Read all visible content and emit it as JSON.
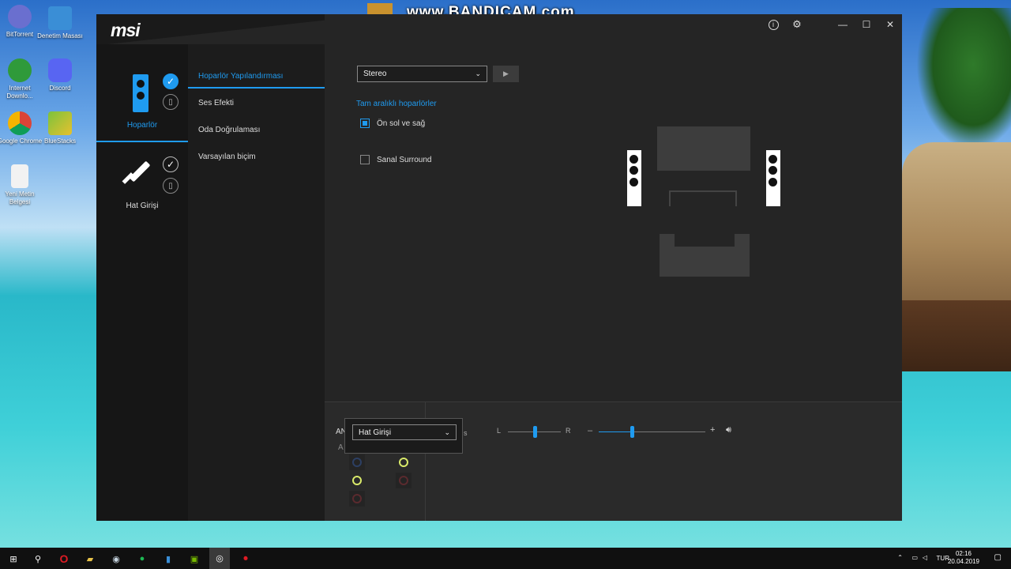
{
  "watermark": "www.BANDICAM.com",
  "desktop_icons": [
    {
      "label": "BitTorrent",
      "color": "#6a6fcf"
    },
    {
      "label": "Denetim Masası",
      "color": "#3a8ed6"
    },
    {
      "label": "Internet Downlo...",
      "color": "#2f9a3a"
    },
    {
      "label": "Discord",
      "color": "#5865f2"
    },
    {
      "label": "Google Chrome",
      "color": "#db4437"
    },
    {
      "label": "BlueStacks",
      "color": "#7cc23c"
    },
    {
      "label": "Yeni Metin Belgesi",
      "color": "#f2f2f2"
    }
  ],
  "window": {
    "brand": "msi",
    "info_icon": "i",
    "settings_icon": "⚙",
    "minimize": "—",
    "maximize": "☐",
    "close": "✕"
  },
  "devices": [
    {
      "label": "Hoparlör",
      "active": true
    },
    {
      "label": "Hat Girişi",
      "active": false
    }
  ],
  "tabs": [
    {
      "label": "Hoparlör Yapılandırması",
      "active": true
    },
    {
      "label": "Ses Efekti",
      "active": false
    },
    {
      "label": "Oda Doğrulaması",
      "active": false
    },
    {
      "label": "Varsayılan biçim",
      "active": false
    }
  ],
  "config": {
    "speaker_select": "Stereo",
    "full_range_title": "Tam aralıklı hoparlörler",
    "front_lr_label": "Ön sol ve sağ",
    "front_lr_checked": true,
    "virtual_surround_label": "Sanal Surround",
    "virtual_surround_checked": false
  },
  "bottom": {
    "analog_label": "AN",
    "analog_sub": "A",
    "popup_select": "Hat Girişi",
    "popup_suffix": "s",
    "balance_left": "L",
    "balance_right": "R",
    "volume_minus": "–",
    "volume_plus": "+",
    "balance_value": 0.5,
    "volume_value": 0.31
  },
  "taskbar": {
    "language": "TUR",
    "time": "02:16",
    "date": "20.04.2019"
  }
}
